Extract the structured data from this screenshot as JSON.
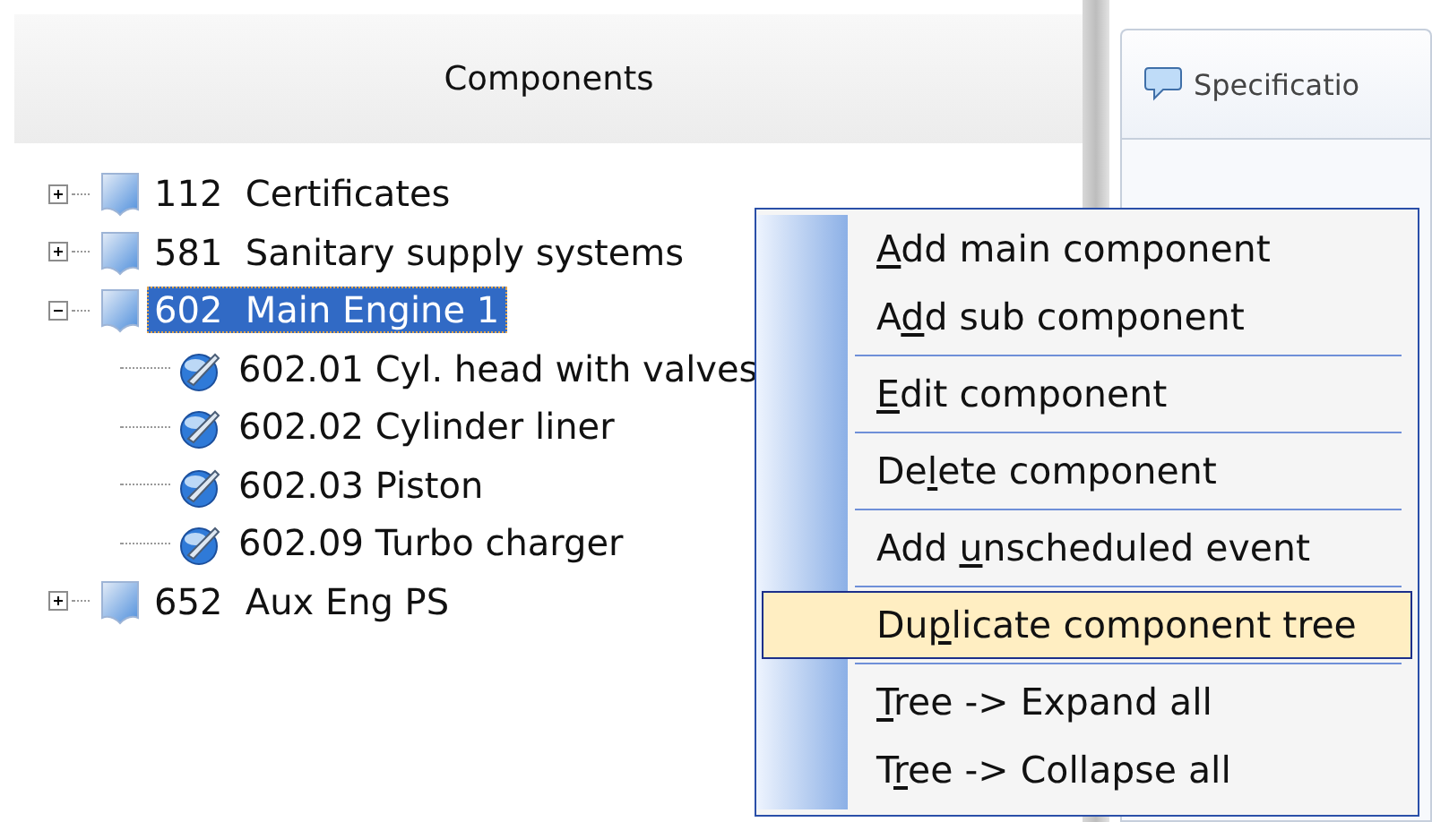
{
  "components_panel": {
    "title": "Components",
    "tree": [
      {
        "label": "112  Certificates",
        "expanded": false,
        "selected": false
      },
      {
        "label": "581  Sanitary supply systems",
        "expanded": false,
        "selected": false
      },
      {
        "label": "602  Main Engine 1",
        "expanded": true,
        "selected": true,
        "children": [
          {
            "label": "602.01 Cyl. head with valves",
            "selected": false
          },
          {
            "label": "602.02 Cylinder liner",
            "selected": false
          },
          {
            "label": "602.03 Piston",
            "selected": false
          },
          {
            "label": "602.09 Turbo charger",
            "selected": false
          }
        ]
      },
      {
        "label": "652  Aux Eng PS",
        "expanded": false,
        "selected": false
      }
    ]
  },
  "right_panel": {
    "tab": {
      "label": "Specificatio",
      "selected": true
    }
  },
  "context_menu": [
    {
      "kind": "item",
      "key": "A",
      "after": "dd main component",
      "selected": false
    },
    {
      "kind": "item",
      "before": "A",
      "key": "d",
      "after": "d sub component",
      "selected": false
    },
    {
      "kind": "separator"
    },
    {
      "kind": "item",
      "key": "E",
      "after": "dit component",
      "selected": false
    },
    {
      "kind": "separator"
    },
    {
      "kind": "item",
      "before": "De",
      "key": "l",
      "after": "ete component",
      "selected": false
    },
    {
      "kind": "separator"
    },
    {
      "kind": "item",
      "before": "Add ",
      "key": "u",
      "after": "nscheduled event",
      "selected": false
    },
    {
      "kind": "separator"
    },
    {
      "kind": "item",
      "before": "Du",
      "key": "p",
      "after": "licate component tree",
      "selected": true
    },
    {
      "kind": "separator"
    },
    {
      "kind": "item",
      "key": "T",
      "after": "ree -> Expand all",
      "selected": false
    },
    {
      "kind": "item",
      "before": "T",
      "key": "r",
      "after": "ee -> Collapse all",
      "selected": false
    }
  ]
}
